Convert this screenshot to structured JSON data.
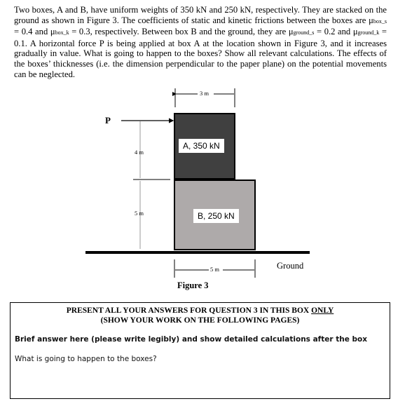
{
  "problem": {
    "p1": "Two boxes, A and B, have uniform weights of 350 kN and 250 kN, respectively. They are stacked on the ground as shown in Figure 3. The coefficients of static and kinetic frictions between the boxes are ",
    "mu_box_s": "μ",
    "mu_box_s_sub": "box_s",
    "p2": " = 0.4 and ",
    "mu_box_k": "μ",
    "mu_box_k_sub": "box_k",
    "p3": " = 0.3, respectively. Between box B and the ground, they are ",
    "mu_ground_s": "μ",
    "mu_ground_s_sub": "ground_s",
    "p4": " = 0.2 and ",
    "mu_ground_k": "μ",
    "mu_ground_k_sub": "ground_k",
    "p5": " = 0.1. A horizontal force P is being applied at box A at the location shown in Figure 3, and it increases gradually in value. What is going to happen to the boxes? Show all relevant calculations. The effects of the boxes’ thicknesses (i.e. the dimension perpendicular to the paper plane) on the potential movements can be neglected."
  },
  "figure": {
    "force_label": "P",
    "box_a_label": "A, 350 kN",
    "box_b_label": "B, 250 kN",
    "dim_top": "3 m",
    "dim_4": "4 m",
    "dim_5v": "5 m",
    "dim_bottom": "5 m",
    "ground_label": "Ground",
    "caption": "Figure 3",
    "box_a_color": "#404040",
    "box_b_color": "#aeaaaa"
  },
  "answer_box": {
    "header1": "PRESENT ALL YOUR ANSWERS FOR QUESTION 3 IN THIS BOX ",
    "header1_underlined": "ONLY",
    "header2": "(SHOW YOUR WORK ON THE FOLLOWING PAGES)",
    "instruction": "Brief answer here (please write legibly) and show detailed calculations after the box",
    "question": "What is going to happen to the boxes?"
  }
}
